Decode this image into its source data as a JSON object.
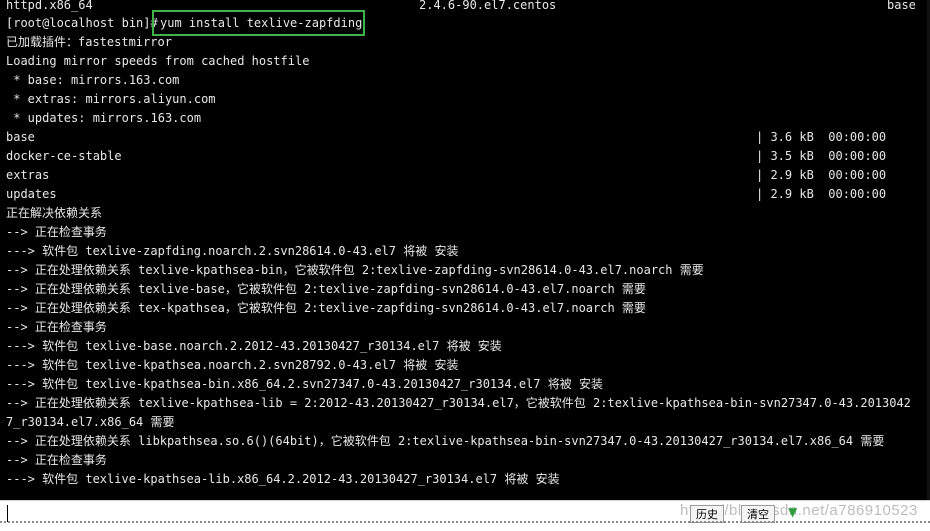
{
  "terminal": {
    "lines": [
      "httpd.x86_64",
      "[root@localhost bin]# ",
      "已加载插件：fastestmirror",
      "Loading mirror speeds from cached hostfile",
      " * base: mirrors.163.com",
      " * extras: mirrors.aliyun.com",
      " * updates: mirrors.163.com",
      "base",
      "docker-ce-stable",
      "extras",
      "updates",
      "正在解决依赖关系",
      "--> 正在检查事务",
      "---> 软件包 texlive-zapfding.noarch.2.svn28614.0-43.el7 将被 安装",
      "--> 正在处理依赖关系 texlive-kpathsea-bin，它被软件包 2:texlive-zapfding-svn28614.0-43.el7.noarch 需要",
      "--> 正在处理依赖关系 texlive-base，它被软件包 2:texlive-zapfding-svn28614.0-43.el7.noarch 需要",
      "--> 正在处理依赖关系 tex-kpathsea，它被软件包 2:texlive-zapfding-svn28614.0-43.el7.noarch 需要",
      "--> 正在检查事务",
      "---> 软件包 texlive-base.noarch.2.2012-43.20130427_r30134.el7 将被 安装",
      "---> 软件包 texlive-kpathsea.noarch.2.svn28792.0-43.el7 将被 安装",
      "---> 软件包 texlive-kpathsea-bin.x86_64.2.svn27347.0-43.20130427_r30134.el7 将被 安装",
      "--> 正在处理依赖关系 texlive-kpathsea-lib = 2:2012-43.20130427_r30134.el7，它被软件包 2:texlive-kpathsea-bin-svn27347.0-43.2013042",
      "7_r30134.el7.x86_64 需要",
      "--> 正在处理依赖关系 libkpathsea.so.6()(64bit)，它被软件包 2:texlive-kpathsea-bin-svn27347.0-43.20130427_r30134.el7.x86_64 需要",
      "--> 正在检查事务",
      "---> 软件包 texlive-kpathsea-lib.x86_64.2.2012-43.20130427_r30134.el7 将被 安装"
    ],
    "command": "yum install texlive-zapfding",
    "top_version": "2.4.6-90.el7.centos",
    "top_repo": "base",
    "repo_rows": [
      {
        "size": "| 3.6 kB  00:00:00"
      },
      {
        "size": "| 3.5 kB  00:00:00"
      },
      {
        "size": "| 2.9 kB  00:00:00"
      },
      {
        "size": "| 2.9 kB  00:00:00"
      }
    ]
  },
  "bottom_bar": {
    "history_label": "历史",
    "clear_label": "清空",
    "watermark": "https://blog.csdn.net/a786910523"
  }
}
